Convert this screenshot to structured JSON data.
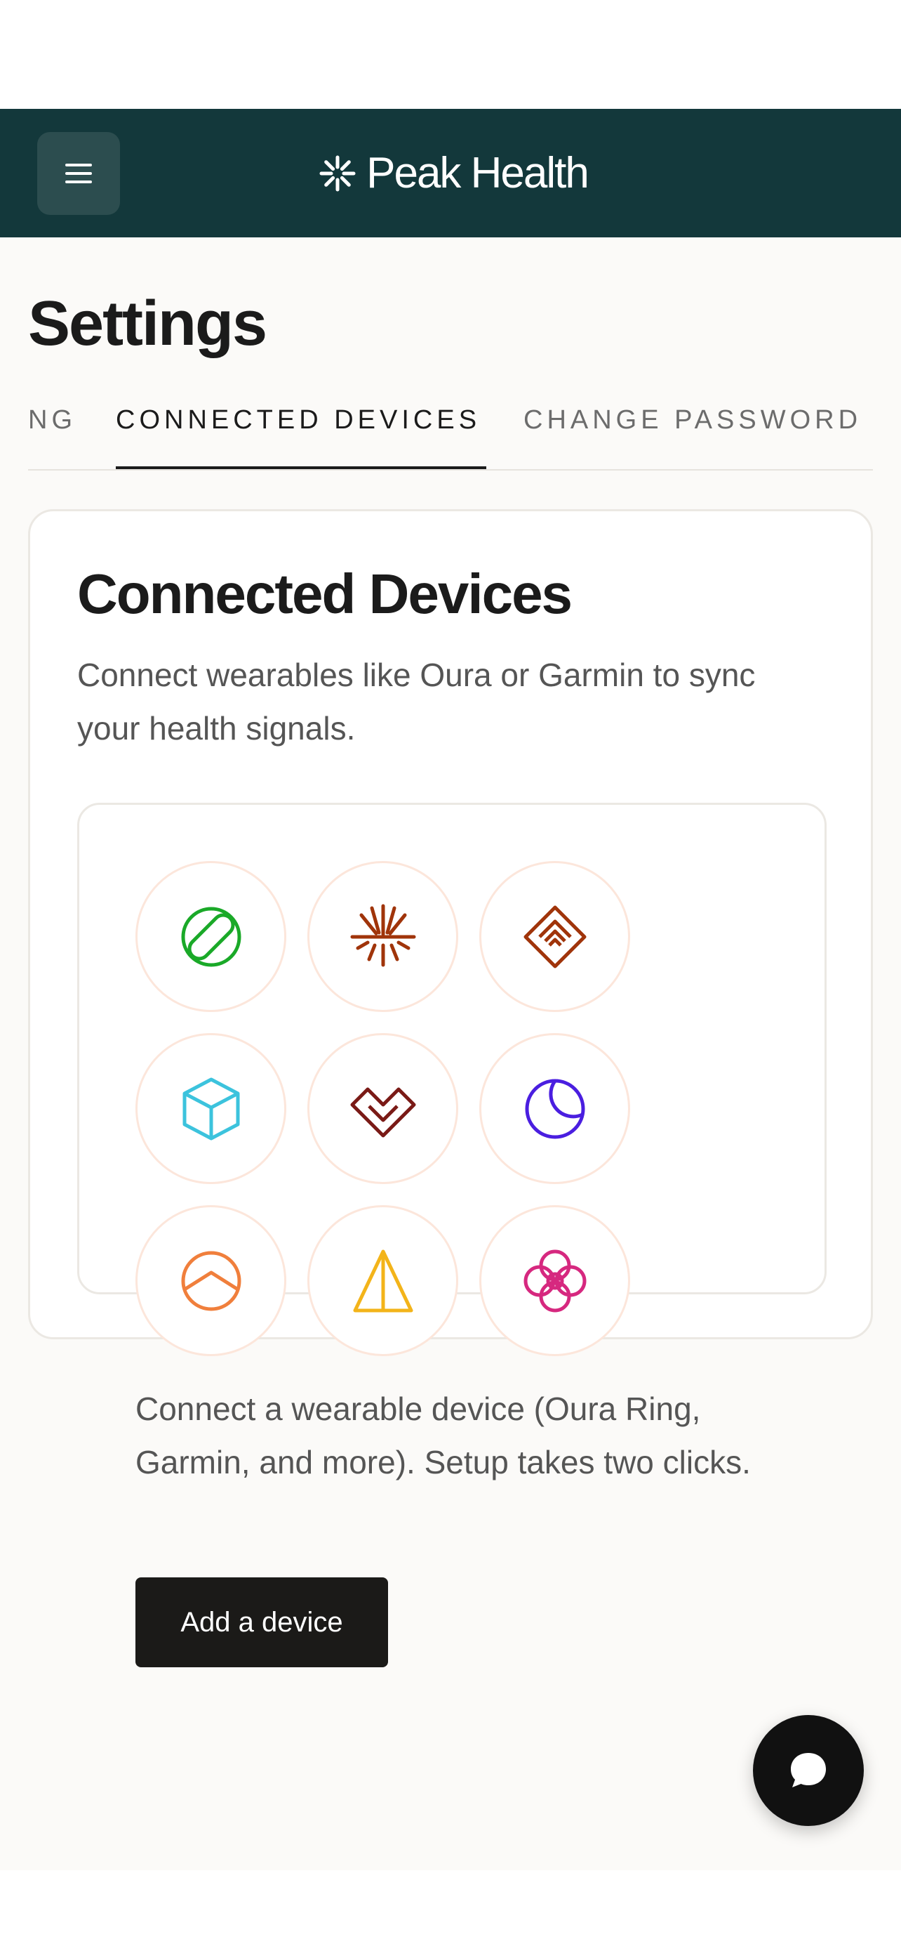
{
  "header": {
    "brand_name": "Peak Health",
    "menu_icon": "hamburger-menu-icon",
    "brand_icon": "asterisk-logo-icon",
    "background_color": "#13383b"
  },
  "page": {
    "title": "Settings"
  },
  "tabs": [
    {
      "label": "NG",
      "active": false
    },
    {
      "label": "CONNECTED DEVICES",
      "active": true
    },
    {
      "label": "CHANGE PASSWORD",
      "active": false
    }
  ],
  "connected_devices": {
    "title": "Connected Devices",
    "description": "Connect wearables like Oura or Garmin to sync your health signals.",
    "device_icons": [
      {
        "name": "pill-icon",
        "color": "#1aa928"
      },
      {
        "name": "starburst-icon",
        "color": "#a0340a"
      },
      {
        "name": "diamond-layers-icon",
        "color": "#a0340a"
      },
      {
        "name": "cube-icon",
        "color": "#3cc3dd"
      },
      {
        "name": "heart-chevron-icon",
        "color": "#7a1a16"
      },
      {
        "name": "moon-icon",
        "color": "#4a1ee0"
      },
      {
        "name": "half-circle-icon",
        "color": "#f07f3c"
      },
      {
        "name": "pyramid-icon",
        "color": "#f3b41a"
      },
      {
        "name": "flower-icon",
        "color": "#d6287f"
      }
    ],
    "empty_state_text": "Connect a wearable device (Oura Ring, Garmin, and more). Setup takes two clicks.",
    "add_button_label": "Add a device"
  },
  "chat": {
    "icon": "chat-bubble-icon"
  }
}
